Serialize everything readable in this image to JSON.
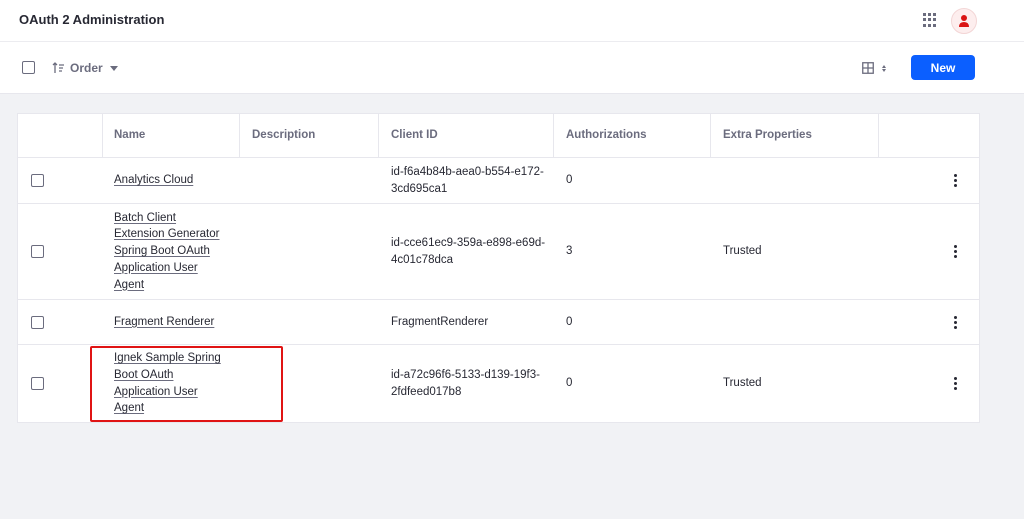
{
  "app": {
    "title": "OAuth 2 Administration"
  },
  "toolbar": {
    "order_label": "Order",
    "new_label": "New"
  },
  "table": {
    "columns": {
      "name": "Name",
      "description": "Description",
      "client_id": "Client ID",
      "authorizations": "Authorizations",
      "extra_properties": "Extra Properties"
    },
    "rows": [
      {
        "name": [
          "Analytics Cloud"
        ],
        "description": "",
        "client_id": [
          "id-f6a4b84b-aea0-b554-e172-",
          "3cd695ca1"
        ],
        "authorizations": "0",
        "extra_properties": ""
      },
      {
        "name": [
          "Batch Client",
          "Extension Generator",
          "Spring Boot OAuth",
          "Application User",
          "Agent"
        ],
        "description": "",
        "client_id": [
          "id-cce61ec9-359a-e898-e69d-",
          "4c01c78dca"
        ],
        "authorizations": "3",
        "extra_properties": "Trusted"
      },
      {
        "name": [
          "Fragment Renderer"
        ],
        "description": "",
        "client_id": [
          "FragmentRenderer"
        ],
        "authorizations": "0",
        "extra_properties": ""
      },
      {
        "name": [
          "Ignek Sample Spring",
          "Boot OAuth",
          "Application User",
          "Agent"
        ],
        "description": "",
        "client_id": [
          "id-a72c96f6-5133-d139-19f3-",
          "2fdfeed017b8"
        ],
        "authorizations": "0",
        "extra_properties": "Trusted"
      }
    ]
  },
  "icons": {
    "apps": "apps-grid-icon",
    "user": "user-avatar-icon",
    "sort": "sort-order-icon",
    "view": "table-view-icon",
    "actions": "kebab-menu-icon"
  },
  "colors": {
    "primary": "#0b5fff",
    "highlight_border": "#e01414",
    "avatar_icon": "#da1414"
  }
}
